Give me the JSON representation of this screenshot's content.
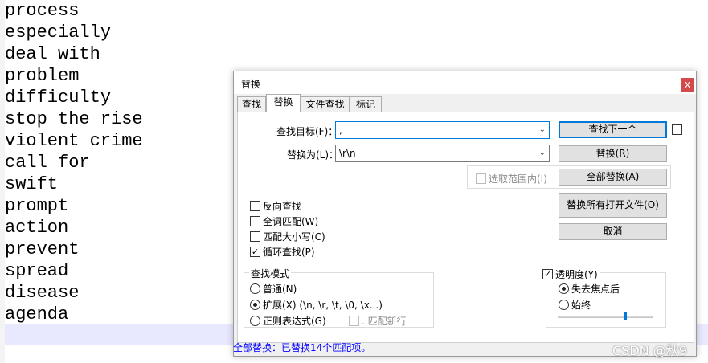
{
  "editor": {
    "lines": [
      "process",
      "especially",
      "deal with",
      "problem",
      "difficulty",
      "stop the rise",
      "violent crime",
      "call for",
      "swift",
      "prompt",
      "action",
      "prevent",
      "spread",
      "disease",
      "agenda"
    ]
  },
  "dialog": {
    "title": "替换",
    "close_glyph": "x",
    "tabs": [
      "查找",
      "替换",
      "文件查找",
      "标记"
    ],
    "find_label": "查找目标(F)：",
    "find_value": ",",
    "replace_label": "替换为(L)：",
    "replace_value": "\\r\\n",
    "in_selection_label": "选取范围内(I)",
    "buttons": {
      "find_next": "查找下一个",
      "replace": "替换(R)",
      "replace_all": "全部替换(A)",
      "replace_all_open": "替换所有打开文件(O)",
      "cancel": "取消"
    },
    "options": [
      {
        "label": "反向查找",
        "checked": false
      },
      {
        "label": "全词匹配(W)",
        "checked": false
      },
      {
        "label": "匹配大小写(C)",
        "checked": false
      },
      {
        "label": "循环查找(P)",
        "checked": true
      }
    ],
    "search_mode": {
      "title": "查找模式",
      "normal": "普通(N)",
      "extended": "扩展(X) (\\n, \\r, \\t, \\0, \\x...)",
      "regex": "正则表达式(G)",
      "match_newline": ". 匹配新行",
      "selected": "extended"
    },
    "transparency": {
      "label": "透明度(Y)",
      "checked": true,
      "on_lose_focus": "失去焦点后",
      "always": "始终",
      "selected": "on_lose_focus",
      "level": 0.7
    },
    "status": "全部替换：已替换14个匹配项。"
  },
  "watermark": "CSDN @秋9",
  "colors": {
    "status_text": "#0000ff",
    "accent": "#0078d7"
  }
}
